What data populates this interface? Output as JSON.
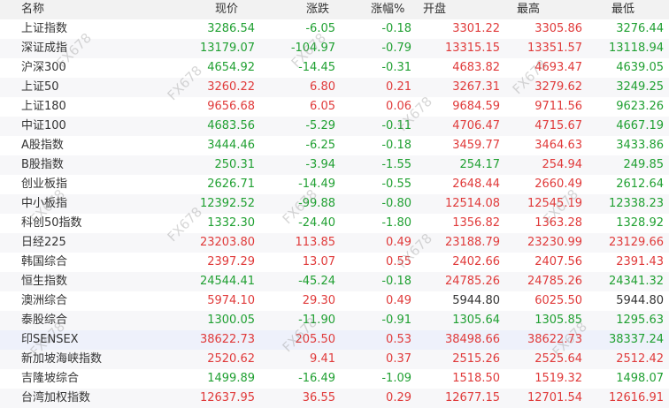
{
  "columns": [
    "名称",
    "现价",
    "涨跌",
    "涨幅%",
    "开盘",
    "最高",
    "最低"
  ],
  "watermark": "FX678",
  "colors": {
    "up": "#e03a3a",
    "down": "#20a032",
    "flat": "#333333"
  },
  "rows": [
    {
      "name": "上证指数",
      "price": "3286.54",
      "change": "-6.05",
      "pct": "-0.18",
      "open": "3301.22",
      "high": "3305.86",
      "low": "3276.44",
      "c": [
        "down",
        "down",
        "down",
        "up",
        "up",
        "down"
      ]
    },
    {
      "name": "深证成指",
      "price": "13179.07",
      "change": "-104.97",
      "pct": "-0.79",
      "open": "13315.15",
      "high": "13351.57",
      "low": "13118.94",
      "c": [
        "down",
        "down",
        "down",
        "up",
        "up",
        "down"
      ]
    },
    {
      "name": "沪深300",
      "price": "4654.92",
      "change": "-14.45",
      "pct": "-0.31",
      "open": "4683.82",
      "high": "4693.47",
      "low": "4639.05",
      "c": [
        "down",
        "down",
        "down",
        "up",
        "up",
        "down"
      ]
    },
    {
      "name": "上证50",
      "price": "3260.22",
      "change": "6.80",
      "pct": "0.21",
      "open": "3267.31",
      "high": "3279.62",
      "low": "3249.25",
      "c": [
        "up",
        "up",
        "up",
        "up",
        "up",
        "down"
      ]
    },
    {
      "name": "上证180",
      "price": "9656.68",
      "change": "6.05",
      "pct": "0.06",
      "open": "9684.59",
      "high": "9711.56",
      "low": "9623.26",
      "c": [
        "up",
        "up",
        "up",
        "up",
        "up",
        "down"
      ]
    },
    {
      "name": "中证100",
      "price": "4683.56",
      "change": "-5.29",
      "pct": "-0.11",
      "open": "4706.47",
      "high": "4715.67",
      "low": "4667.19",
      "c": [
        "down",
        "down",
        "down",
        "up",
        "up",
        "down"
      ]
    },
    {
      "name": "A股指数",
      "price": "3444.46",
      "change": "-6.25",
      "pct": "-0.18",
      "open": "3459.77",
      "high": "3464.63",
      "low": "3433.86",
      "c": [
        "down",
        "down",
        "down",
        "up",
        "up",
        "down"
      ]
    },
    {
      "name": "B股指数",
      "price": "250.31",
      "change": "-3.94",
      "pct": "-1.55",
      "open": "254.17",
      "high": "254.94",
      "low": "249.85",
      "c": [
        "down",
        "down",
        "down",
        "down",
        "up",
        "down"
      ]
    },
    {
      "name": "创业板指",
      "price": "2626.71",
      "change": "-14.49",
      "pct": "-0.55",
      "open": "2648.44",
      "high": "2660.49",
      "low": "2612.64",
      "c": [
        "down",
        "down",
        "down",
        "up",
        "up",
        "down"
      ]
    },
    {
      "name": "中小板指",
      "price": "12392.52",
      "change": "-99.88",
      "pct": "-0.80",
      "open": "12514.08",
      "high": "12545.19",
      "low": "12338.23",
      "c": [
        "down",
        "down",
        "down",
        "up",
        "up",
        "down"
      ]
    },
    {
      "name": "科创50指数",
      "price": "1332.30",
      "change": "-24.40",
      "pct": "-1.80",
      "open": "1356.82",
      "high": "1363.28",
      "low": "1328.92",
      "c": [
        "down",
        "down",
        "down",
        "up",
        "up",
        "down"
      ]
    },
    {
      "name": "日经225",
      "price": "23203.80",
      "change": "113.85",
      "pct": "0.49",
      "open": "23188.79",
      "high": "23230.99",
      "low": "23129.66",
      "c": [
        "up",
        "up",
        "up",
        "up",
        "up",
        "up"
      ]
    },
    {
      "name": "韩国综合",
      "price": "2397.29",
      "change": "13.07",
      "pct": "0.55",
      "open": "2402.66",
      "high": "2407.56",
      "low": "2391.43",
      "c": [
        "up",
        "up",
        "up",
        "up",
        "up",
        "up"
      ]
    },
    {
      "name": "恒生指数",
      "price": "24544.41",
      "change": "-45.24",
      "pct": "-0.18",
      "open": "24785.26",
      "high": "24785.26",
      "low": "24341.32",
      "c": [
        "down",
        "down",
        "down",
        "up",
        "up",
        "down"
      ]
    },
    {
      "name": "澳洲综合",
      "price": "5974.10",
      "change": "29.30",
      "pct": "0.49",
      "open": "5944.80",
      "high": "6025.50",
      "low": "5944.80",
      "c": [
        "up",
        "up",
        "up",
        "flat",
        "up",
        "flat"
      ]
    },
    {
      "name": "泰股综合",
      "price": "1300.05",
      "change": "-11.90",
      "pct": "-0.91",
      "open": "1305.64",
      "high": "1305.85",
      "low": "1295.63",
      "c": [
        "down",
        "down",
        "down",
        "down",
        "down",
        "down"
      ]
    },
    {
      "name": "印SENSEX",
      "price": "38622.73",
      "change": "205.50",
      "pct": "0.53",
      "open": "38498.66",
      "high": "38622.73",
      "low": "38337.24",
      "c": [
        "up",
        "up",
        "up",
        "up",
        "up",
        "down"
      ]
    },
    {
      "name": "新加坡海峡指数",
      "price": "2520.62",
      "change": "9.41",
      "pct": "0.37",
      "open": "2515.26",
      "high": "2525.64",
      "low": "2512.42",
      "c": [
        "up",
        "up",
        "up",
        "up",
        "up",
        "up"
      ]
    },
    {
      "name": "吉隆坡综合",
      "price": "1499.89",
      "change": "-16.49",
      "pct": "-1.09",
      "open": "1518.50",
      "high": "1519.32",
      "low": "1498.07",
      "c": [
        "down",
        "down",
        "down",
        "up",
        "up",
        "down"
      ]
    },
    {
      "name": "台湾加权指数",
      "price": "12637.95",
      "change": "36.55",
      "pct": "0.29",
      "open": "12677.15",
      "high": "12701.54",
      "low": "12616.91",
      "c": [
        "up",
        "up",
        "up",
        "up",
        "up",
        "up"
      ]
    }
  ]
}
